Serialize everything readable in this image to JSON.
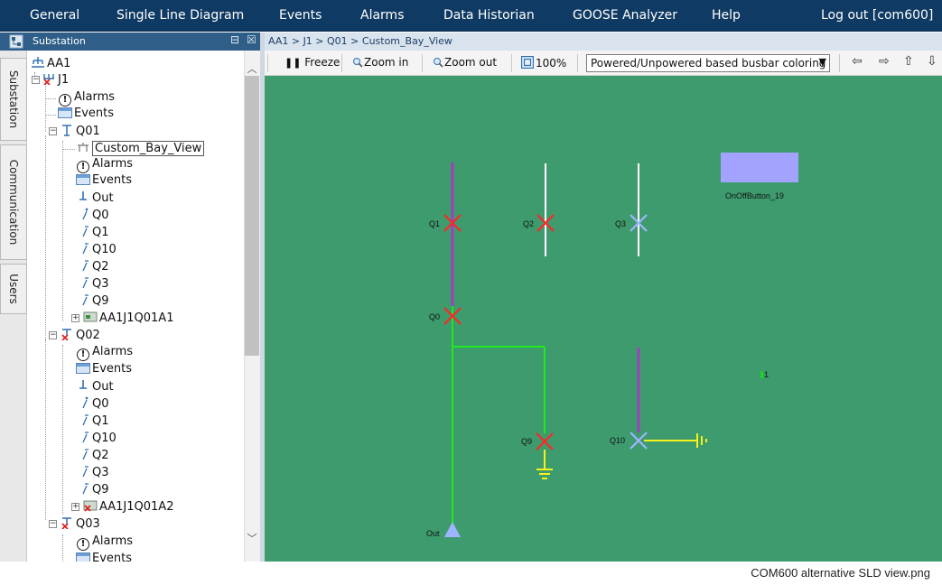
{
  "menu": {
    "items": [
      "General",
      "Single Line Diagram",
      "Events",
      "Alarms",
      "Data Historian",
      "GOOSE Analyzer",
      "Help"
    ],
    "logout": "Log out [com600]"
  },
  "panel": {
    "title": "Substation",
    "pin_glyph": "⊟",
    "close_glyph": "☒"
  },
  "side_tabs": [
    "Substation",
    "Communication",
    "Users"
  ],
  "tree": {
    "root": "AA1",
    "voltage_level": "J1",
    "alarms": "Alarms",
    "events": "Events",
    "bays": [
      {
        "name": "Q01",
        "children": [
          "Custom_Bay_View",
          "Alarms",
          "Events",
          "Out",
          "Q0",
          "Q1",
          "Q10",
          "Q2",
          "Q3",
          "Q9",
          "AA1J1Q01A1"
        ]
      },
      {
        "name": "Q02",
        "children": [
          "Alarms",
          "Events",
          "Out",
          "Q0",
          "Q1",
          "Q10",
          "Q2",
          "Q3",
          "Q9",
          "AA1J1Q01A2"
        ]
      },
      {
        "name": "Q03",
        "children": [
          "Alarms",
          "Events"
        ]
      }
    ]
  },
  "breadcrumb": "AA1 > J1 > Q01 > Custom_Bay_View",
  "toolbar": {
    "freeze": "Freeze",
    "zoom_in": "Zoom in",
    "zoom_out": "Zoom out",
    "zoom_level": "100%",
    "coloring_mode": "Powered/Unpowered based busbar coloring"
  },
  "diagram": {
    "background": "#3e9b6e",
    "labels": {
      "q1": "Q1",
      "q2": "Q2",
      "q3": "Q3",
      "q0": "Q0",
      "q9": "Q9",
      "q10": "Q10",
      "out": "Out",
      "button": "OnOffButton_19",
      "value": "1"
    },
    "colors": {
      "powered_line": "#a23fbf",
      "grounded_line": "#23e623",
      "earth_line": "#f2f21c",
      "unknown_line": "#ffffff",
      "breaker_closed": "#ff2626",
      "breaker_unknown": "#9fb4ff",
      "button": "#a3a3ff"
    }
  },
  "caption": "COM600  alternative  SLD  view.png"
}
